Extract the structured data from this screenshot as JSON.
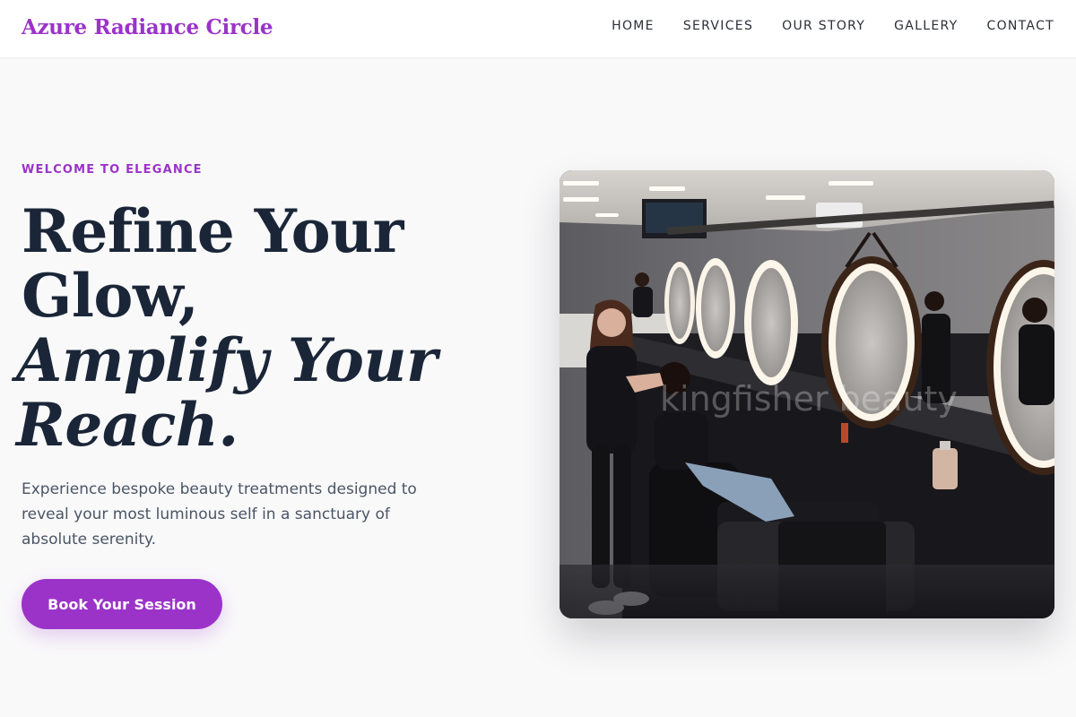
{
  "header": {
    "brand": "Azure Radiance Circle",
    "nav": [
      {
        "label": "HOME"
      },
      {
        "label": "SERVICES"
      },
      {
        "label": "OUR STORY"
      },
      {
        "label": "GALLERY"
      },
      {
        "label": "CONTACT"
      }
    ]
  },
  "hero": {
    "eyebrow": "WELCOME TO ELEGANCE",
    "headline": {
      "line1": "Refine Your",
      "line2": "Glow,",
      "line3": "Amplify Your",
      "line4": "Reach."
    },
    "lead": "Experience bespoke beauty treatments designed to reveal your most luminous self in a sanctuary of absolute serenity.",
    "cta_label": "Book Your Session",
    "photo_watermark": "kingfisher beauty"
  },
  "colors": {
    "accent": "#9b33c9",
    "heading": "#1a2638",
    "body_text": "#4a5565",
    "background": "#f9f9fa"
  }
}
